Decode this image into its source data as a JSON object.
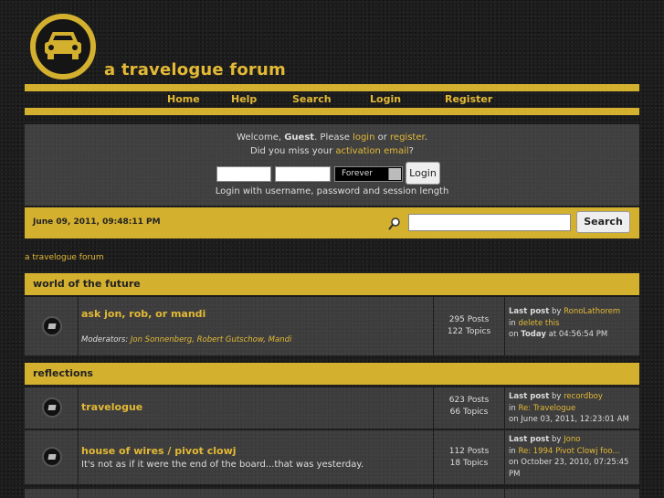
{
  "site": {
    "title": "a travelogue forum",
    "logo_icon": "car-icon"
  },
  "nav": {
    "items": [
      "Home",
      "Help",
      "Search",
      "Login",
      "Register"
    ]
  },
  "login": {
    "welcome_prefix": "Welcome, ",
    "guest": "Guest",
    "please": ". Please ",
    "login_link": "login",
    "or": " or ",
    "register_link": "register",
    "period": ".",
    "missed_prefix": "Did you miss your ",
    "activation_link": "activation email",
    "missed_suffix": "?",
    "username_value": "",
    "password_value": "",
    "session_length": "Forever",
    "button": "Login",
    "hint": "Login with username, password and session length"
  },
  "infobar": {
    "datetime": "June 09, 2011, 09:48:11 PM",
    "search_value": "",
    "search_button": "Search"
  },
  "breadcrumb": "a travelogue forum",
  "categories": [
    {
      "name": "world of the future",
      "boards": [
        {
          "name": "ask jon, rob, or mandi",
          "moderators_label": "Moderators: ",
          "moderators": "Jon Sonnenberg, Robert Gutschow, Mandi",
          "posts": "295 Posts",
          "topics": "122 Topics",
          "last_post_label": "Last post",
          "by": " by ",
          "last_author": "RonoLathorem",
          "in": "in ",
          "last_topic": "delete this",
          "on": "on ",
          "last_when_bold": "Today",
          "last_time": " at 04:56:54 PM"
        }
      ]
    },
    {
      "name": "reflections",
      "boards": [
        {
          "name": "travelogue",
          "posts": "623 Posts",
          "topics": "66 Topics",
          "last_post_label": "Last post",
          "by": " by ",
          "last_author": "recordboy",
          "in": "in ",
          "last_topic": "Re: Travelogue",
          "on": "on ",
          "last_time": "June 03, 2011, 12:23:01 AM"
        },
        {
          "name": "house of wires / pivot clowj",
          "description": "It's not as if it were the end of the board...that was yesterday.",
          "posts": "112 Posts",
          "topics": "18 Topics",
          "last_post_label": "Last post",
          "by": " by ",
          "last_author": "Jono",
          "in": "in ",
          "last_topic": "Re: 1994 Pivot Clowj foo...",
          "on": "on ",
          "last_time": "October 23, 2010, 07:25:45 PM"
        }
      ]
    }
  ],
  "colors": {
    "accent": "#d4b02f",
    "link": "#e3b935",
    "panel": "#5a5a5a",
    "background": "#1c1c1c"
  }
}
